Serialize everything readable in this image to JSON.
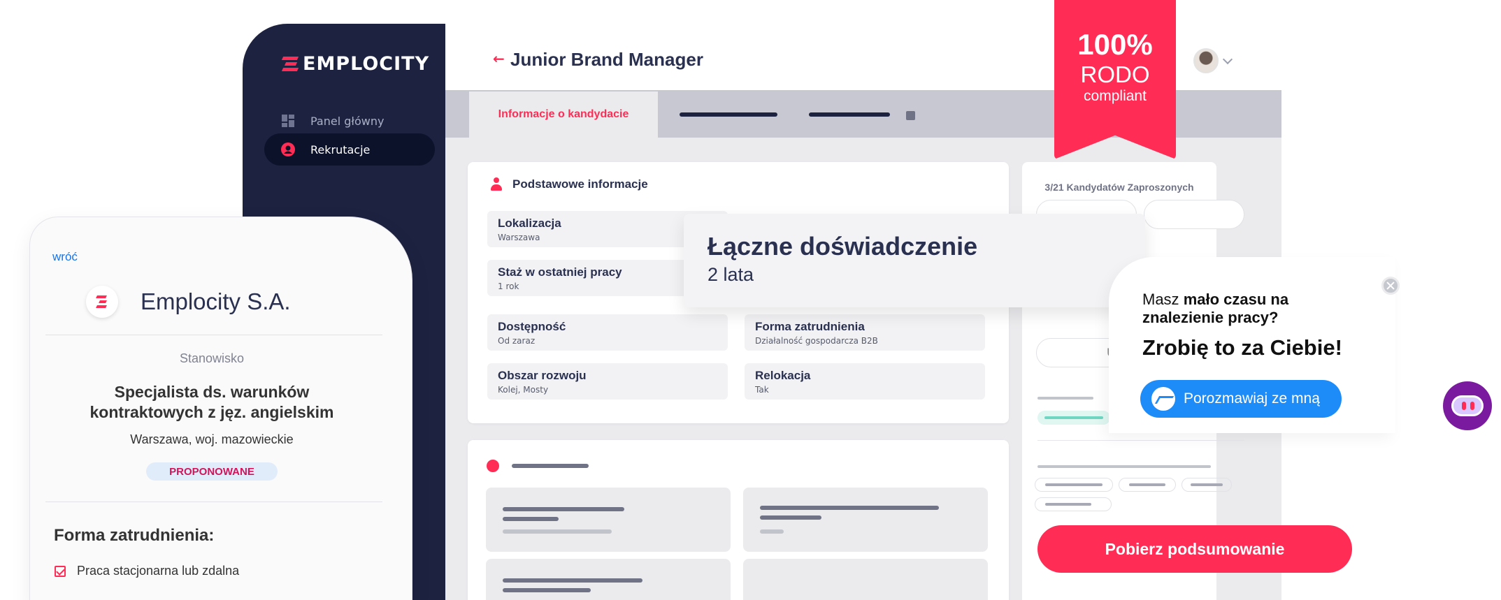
{
  "app": {
    "logo_text": "EMPLOCITY",
    "page_title": "Junior Brand Manager"
  },
  "sidebar": {
    "items": [
      {
        "label": "Panel główny",
        "icon": "dashboard-icon"
      },
      {
        "label": "Rekrutacje",
        "icon": "recruitment-icon"
      }
    ]
  },
  "tabs": {
    "active_label": "Informacje o kandydacie"
  },
  "basic_info": {
    "title": "Podstawowe informacje",
    "fields": [
      {
        "label": "Lokalizacja",
        "value": "Warszawa"
      },
      {
        "label": "Staż w ostatniej pracy",
        "value": "1 rok"
      },
      {
        "label": "Dostępność",
        "value": "Od zaraz"
      },
      {
        "label": "Forma zatrudnienia",
        "value": "Działalność gospodarcza B2B"
      },
      {
        "label": "Obszar rozwoju",
        "value": "Kolej, Mosty"
      },
      {
        "label": "Relokacja",
        "value": "Tak"
      }
    ]
  },
  "experience": {
    "title": "Łączne doświadczenie",
    "value": "2 lata"
  },
  "right_panel": {
    "invited": "3/21 Kandydatów Zaproszonych",
    "partial_text": "U"
  },
  "ribbon": {
    "line1": "100%",
    "line2": "RODO",
    "line3": "compliant"
  },
  "chat": {
    "question_prefix": "Masz ",
    "question_bold": "mało czasu na znalezienie pracy?",
    "answer": "Zrobię to za Ciebie!",
    "button_label": "Porozmawiaj ze mną"
  },
  "download_button": "Pobierz podsumowanie",
  "mobile": {
    "back_link": "wróć",
    "company_name": "Emplocity S.A.",
    "position_label": "Stanowisko",
    "position_title": "Specjalista ds. warunków kontraktowych z jęz. angielskim",
    "location": "Warszawa, woj. mazowieckie",
    "badge": "PROPONOWANE",
    "employment_heading": "Forma zatrudnienia:",
    "employment_option": "Praca stacjonarna lub zdalna"
  },
  "colors": {
    "accent": "#ff2d55",
    "sidebar": "#1d2240",
    "messenger": "#1d8cf8",
    "bot": "#7a1a9e"
  }
}
